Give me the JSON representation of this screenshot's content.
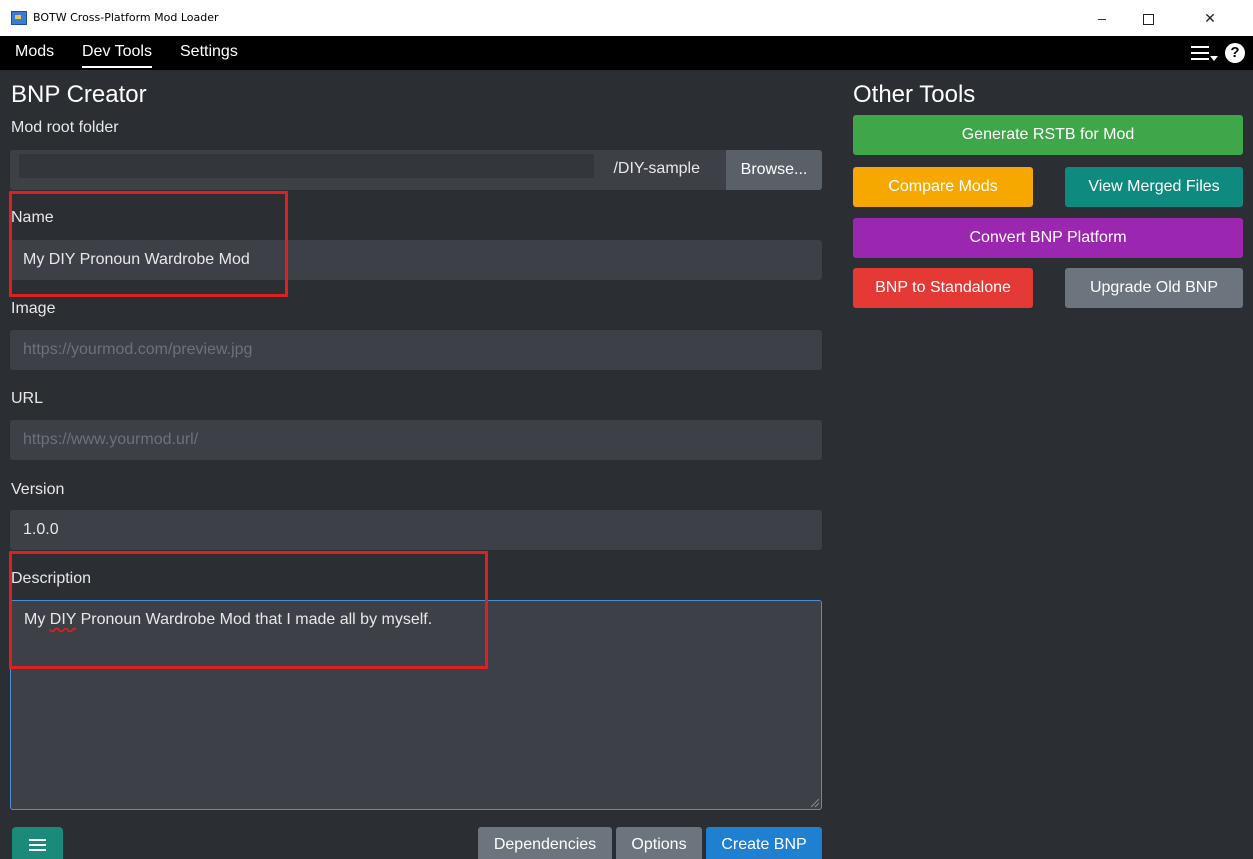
{
  "window": {
    "title": "BOTW Cross-Platform Mod Loader",
    "controls": {
      "minimize": "–",
      "maximize": "□",
      "close": "✕"
    }
  },
  "nav": {
    "tabs": [
      {
        "label": "Mods"
      },
      {
        "label": "Dev Tools",
        "active": true
      },
      {
        "label": "Settings"
      }
    ],
    "help_label": "?"
  },
  "bnp_creator": {
    "title": "BNP Creator",
    "mod_root_folder": {
      "label": "Mod root folder",
      "value": "/DIY-sample",
      "browse_label": "Browse..."
    },
    "name": {
      "label": "Name",
      "value": "My DIY Pronoun Wardrobe Mod"
    },
    "image": {
      "label": "Image",
      "placeholder": "https://yourmod.com/preview.jpg"
    },
    "url": {
      "label": "URL",
      "placeholder": "https://www.yourmod.url/"
    },
    "version": {
      "label": "Version",
      "value": "1.0.0"
    },
    "description": {
      "label": "Description",
      "value_prefix": "My ",
      "value_misspelled": "DIY",
      "value_suffix": " Pronoun Wardrobe Mod that I made all by myself."
    },
    "buttons": {
      "dependencies": "Dependencies",
      "options": "Options",
      "create": "Create BNP"
    }
  },
  "other_tools": {
    "title": "Other Tools",
    "buttons": {
      "generate_rstb": "Generate RSTB for Mod",
      "compare_mods": "Compare Mods",
      "view_merged": "View Merged Files",
      "convert_platform": "Convert BNP Platform",
      "bnp_standalone": "BNP to Standalone",
      "upgrade_old": "Upgrade Old BNP"
    }
  },
  "colors": {
    "background": "#2b2e33",
    "input_bg": "#3d4046",
    "green": "#3fa64a",
    "orange": "#f7a800",
    "teal": "#0f8a7e",
    "purple": "#9b27b0",
    "red": "#e53935",
    "gray": "#6c757d",
    "blue": "#1f7fd1",
    "highlight_red": "#e02020"
  }
}
